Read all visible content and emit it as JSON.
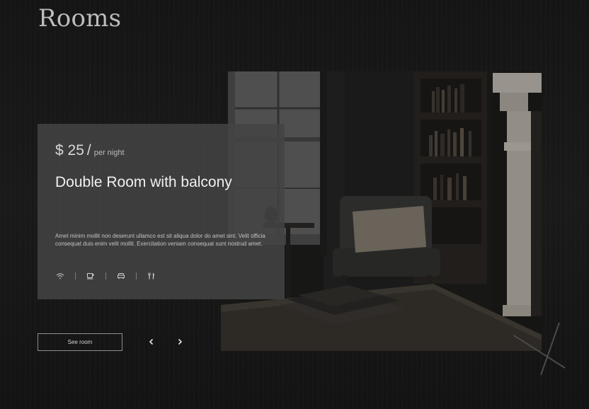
{
  "page": {
    "title": "Rooms"
  },
  "room": {
    "price_amount": "$ 25",
    "price_separator": "/",
    "price_unit": "per night",
    "name": "Double Room with balcony",
    "description": "Amet minim mollit non deserunt ullamco est sit aliqua dolor do amet sint. Velit officia consequat duis enim velit mollit. Exercitation veniam consequat sunt nostrud amet.",
    "amenities": [
      "wifi-icon",
      "coffee-cup-icon",
      "car-icon",
      "restaurant-icon"
    ],
    "photo": "dim-room-armchair-bookshelf-fireplace"
  },
  "actions": {
    "see_room_label": "See room"
  },
  "navigation": {
    "prev": "chevron-left-icon",
    "next": "chevron-right-icon"
  },
  "colors": {
    "background": "#141414",
    "card": "#444444",
    "title": "#bdbdbd",
    "text": "#f0f0f0",
    "muted_text": "#c4c4c4"
  }
}
